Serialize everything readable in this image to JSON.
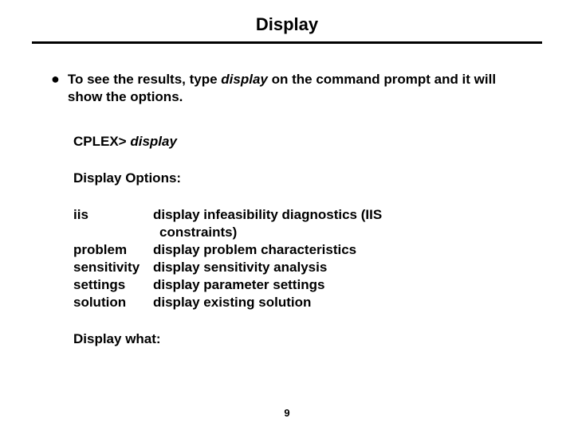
{
  "title": "Display",
  "bullet": {
    "pre": "To see the results, type ",
    "cmd": "display",
    "post": " on the command prompt and it will show the options."
  },
  "prompt_label": "CPLEX> ",
  "prompt_cmd": "display",
  "options_label": "Display Options:",
  "options": [
    {
      "key": "iis",
      "desc": "display infeasibility diagnostics (IIS",
      "cont": "constraints)"
    },
    {
      "key": "problem",
      "desc": "display problem characteristics",
      "cont": ""
    },
    {
      "key": "sensitivity",
      "desc": "display sensitivity analysis",
      "cont": ""
    },
    {
      "key": "settings",
      "desc": "display parameter settings",
      "cont": ""
    },
    {
      "key": "solution",
      "desc": "display existing solution",
      "cont": ""
    }
  ],
  "display_what": "Display what:",
  "page_number": "9"
}
